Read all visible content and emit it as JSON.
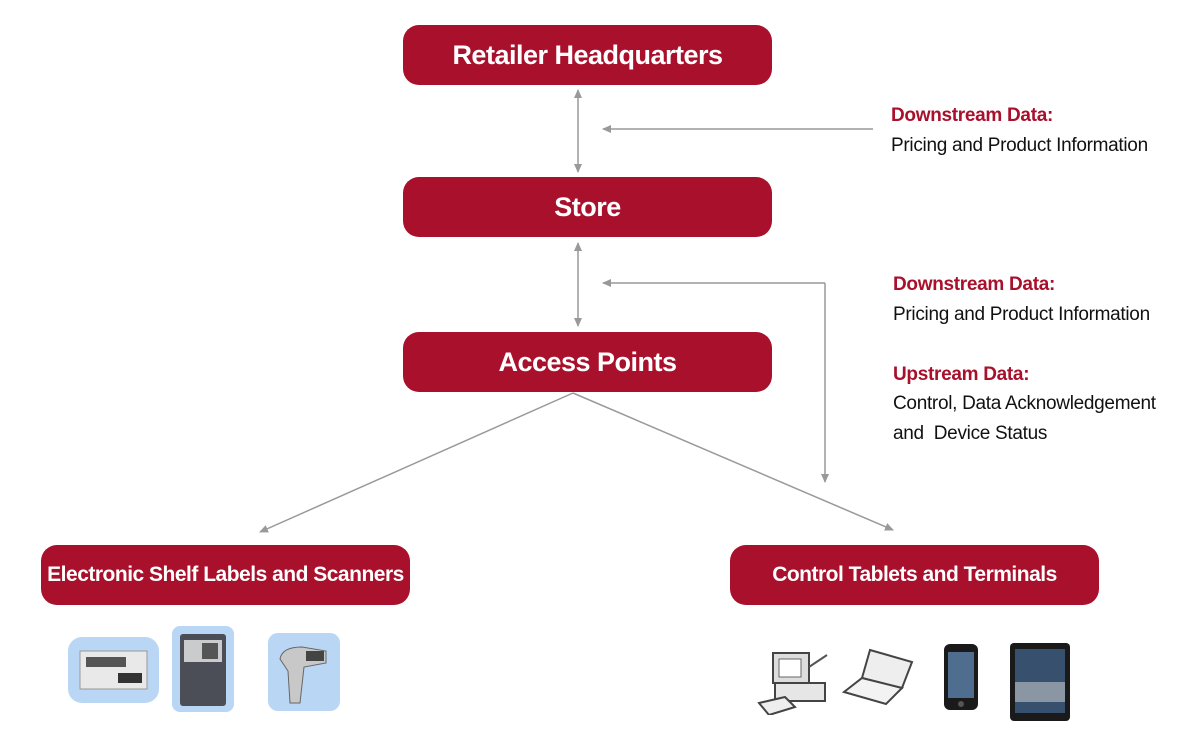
{
  "nodes": {
    "hq": "Retailer Headquarters",
    "store": "Store",
    "access_points": "Access Points",
    "esl": "Electronic Shelf Labels and Scanners",
    "control": "Control Tablets and Terminals"
  },
  "annotations": {
    "hq_store": {
      "title": "Downstream Data:",
      "text": "Pricing and Product Information"
    },
    "store_ap_down": {
      "title": "Downstream Data:",
      "text": "Pricing and Product Information"
    },
    "store_ap_up": {
      "title": "Upstream Data:",
      "line1": "Control, Data Acknowledgement",
      "line2": "and  Device Status"
    }
  },
  "colors": {
    "node": "#a8102c",
    "arrow": "#999999",
    "heading": "#a8102c"
  },
  "devices": {
    "esl": [
      "shelf-label-icon",
      "handheld-terminal-icon",
      "barcode-scanner-icon"
    ],
    "control": [
      "desktop-computer-icon",
      "laptop-icon",
      "smartphone-icon",
      "tablet-icon"
    ]
  }
}
